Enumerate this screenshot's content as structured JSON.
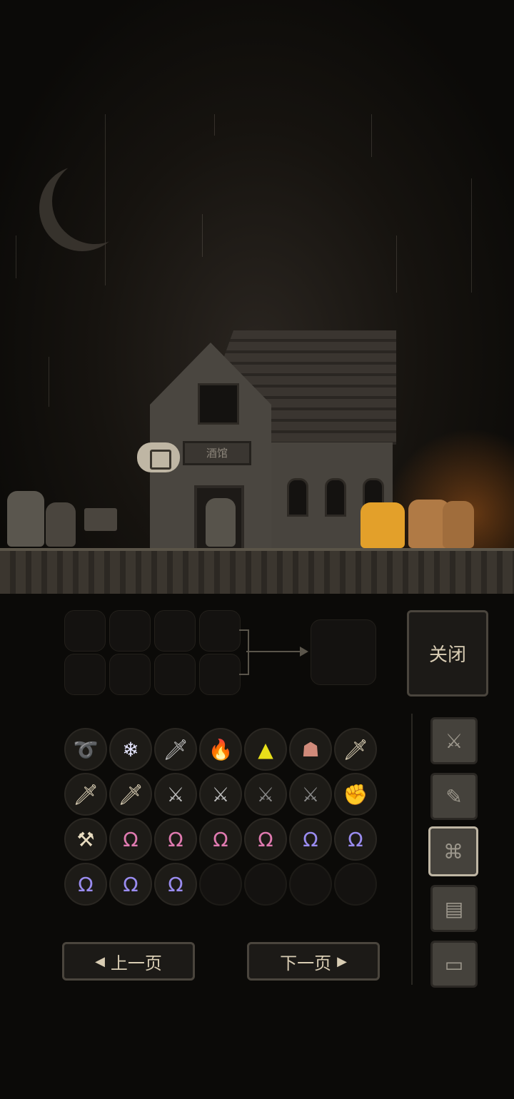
{
  "scene": {
    "sign_text": "酒馆"
  },
  "crafting": {
    "close_label": "关闭"
  },
  "inventory": {
    "items": [
      {
        "icon": "ring-icon",
        "glyph": "➰",
        "color": "#9ecbff"
      },
      {
        "icon": "crystal-icon",
        "glyph": "❄",
        "color": "#e6e6ff"
      },
      {
        "icon": "dagger-icon",
        "glyph": "🗡",
        "color": "#cccccc"
      },
      {
        "icon": "fire-amulet-icon",
        "glyph": "🔥",
        "color": "#ff7a1a"
      },
      {
        "icon": "gold-pyramid-icon",
        "glyph": "▲",
        "color": "#e8e01a"
      },
      {
        "icon": "skull-box-icon",
        "glyph": "☗",
        "color": "#d08a7a"
      },
      {
        "icon": "wooden-sword-icon",
        "glyph": "🗡",
        "color": "#e8dcc0"
      },
      {
        "icon": "wooden-sword-icon",
        "glyph": "🗡",
        "color": "#e8dcc0"
      },
      {
        "icon": "wooden-sword-icon",
        "glyph": "🗡",
        "color": "#e8dcc0"
      },
      {
        "icon": "short-sword-icon",
        "glyph": "⚔",
        "color": "#bbbbbb"
      },
      {
        "icon": "short-sword-icon",
        "glyph": "⚔",
        "color": "#bbbbbb"
      },
      {
        "icon": "dark-sword-icon",
        "glyph": "⚔",
        "color": "#888888"
      },
      {
        "icon": "dark-sword-icon",
        "glyph": "⚔",
        "color": "#888888"
      },
      {
        "icon": "stone-gauntlet-icon",
        "glyph": "✊",
        "color": "#aaa49a"
      },
      {
        "icon": "axe-icon",
        "glyph": "⚒",
        "color": "#e8dcc0"
      },
      {
        "icon": "pink-necklace-icon",
        "glyph": "Ω",
        "color": "#e07ab0"
      },
      {
        "icon": "pink-necklace-icon",
        "glyph": "Ω",
        "color": "#e07ab0"
      },
      {
        "icon": "pink-necklace-icon",
        "glyph": "Ω",
        "color": "#e07ab0"
      },
      {
        "icon": "pink-necklace-icon",
        "glyph": "Ω",
        "color": "#e07ab0"
      },
      {
        "icon": "blue-necklace-icon",
        "glyph": "Ω",
        "color": "#9a8cf0"
      },
      {
        "icon": "blue-necklace-icon",
        "glyph": "Ω",
        "color": "#9a8cf0"
      },
      {
        "icon": "blue-necklace-icon",
        "glyph": "Ω",
        "color": "#9a8cf0"
      },
      {
        "icon": "blue-necklace-icon",
        "glyph": "Ω",
        "color": "#9a8cf0"
      },
      {
        "icon": "blue-necklace-icon",
        "glyph": "Ω",
        "color": "#9a8cf0"
      }
    ],
    "empty_slots": 4,
    "prev_label": "上一页",
    "next_label": "下一页",
    "prev_arrow": "◀",
    "next_arrow": "▶"
  },
  "side_tabs": [
    {
      "icon": "crossed-swords-icon",
      "glyph": "⚔",
      "active": false
    },
    {
      "icon": "scroll-quill-icon",
      "glyph": "✎",
      "active": false
    },
    {
      "icon": "crafting-map-icon",
      "glyph": "⌘",
      "active": true
    },
    {
      "icon": "documents-icon",
      "glyph": "▤",
      "active": false
    },
    {
      "icon": "computer-icon",
      "glyph": "▭",
      "active": false
    }
  ]
}
